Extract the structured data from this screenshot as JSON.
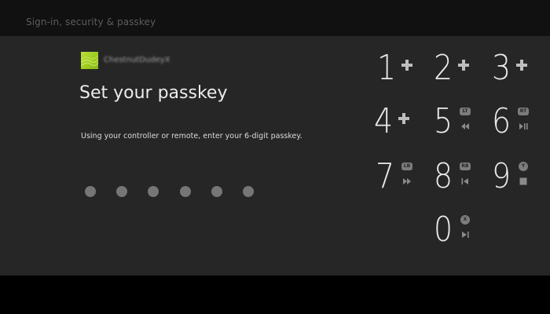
{
  "header": {
    "title": "Sign-in, security & passkey"
  },
  "account": {
    "gamertag": "ChestnutDudeyX"
  },
  "main": {
    "heading": "Set your passkey",
    "instructions": "Using your controller or remote, enter your 6-digit passkey."
  },
  "passkey": {
    "length": 6,
    "entered": 0
  },
  "keypad": {
    "keys": [
      {
        "digit": "1",
        "shortcut_icon": "dpad-plus-icon"
      },
      {
        "digit": "2",
        "shortcut_icon": "dpad-plus-icon"
      },
      {
        "digit": "3",
        "shortcut_icon": "dpad-plus-icon"
      },
      {
        "digit": "4",
        "shortcut_icon": "dpad-plus-icon"
      },
      {
        "digit": "5",
        "shortcut_icon": "left-trigger-icon",
        "badge": "LT",
        "media_icon": "rewind-icon"
      },
      {
        "digit": "6",
        "shortcut_icon": "right-trigger-icon",
        "badge": "RT",
        "media_icon": "play-pause-icon"
      },
      {
        "digit": "7",
        "shortcut_icon": "left-bumper-icon",
        "badge": "LB",
        "media_icon": "fast-forward-icon"
      },
      {
        "digit": "8",
        "shortcut_icon": "right-bumper-icon",
        "badge": "RB",
        "media_icon": "skip-back-icon"
      },
      {
        "digit": "9",
        "shortcut_icon": "y-button-icon",
        "badge": "Y",
        "media_icon": "stop-icon"
      },
      {
        "digit": "0",
        "shortcut_icon": "x-button-icon",
        "badge": "X",
        "media_icon": "skip-forward-icon"
      }
    ]
  },
  "colors": {
    "background": "#000000",
    "panel": "#262626",
    "header_bar": "#111111",
    "text_primary": "#ececec",
    "text_muted": "#5c5c5c",
    "dot": "#767676",
    "accent_green": "#9ccb1e"
  }
}
